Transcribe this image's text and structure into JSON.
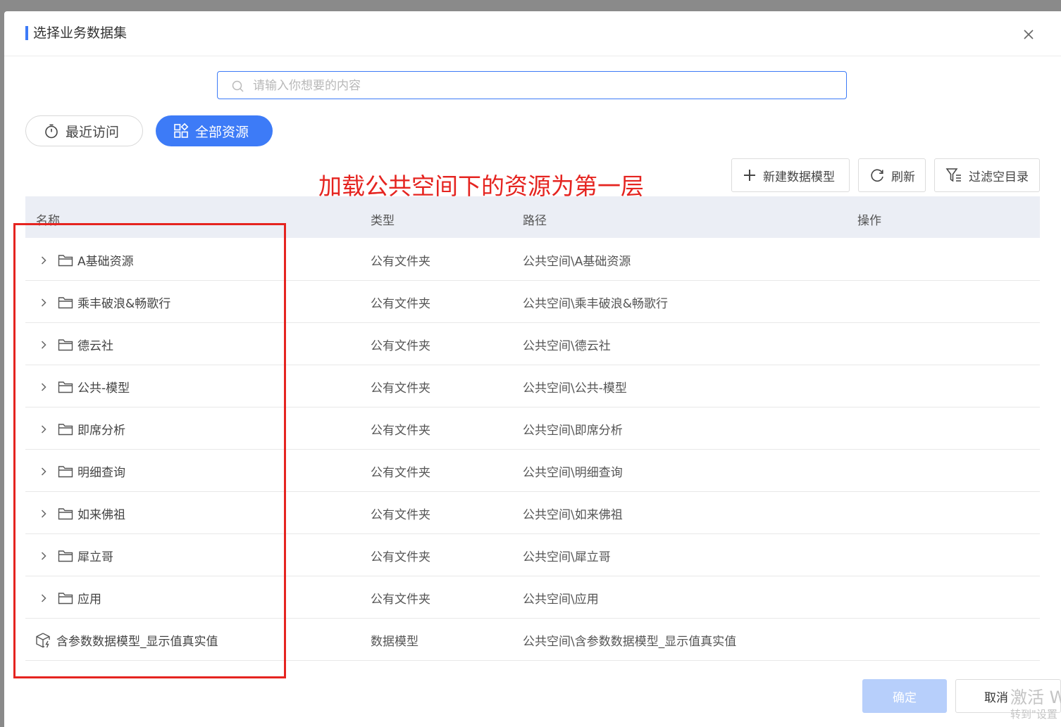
{
  "dialog": {
    "title": "选择业务数据集",
    "accent_color": "#3d7bf7"
  },
  "search": {
    "placeholder": "请输入你想要的内容",
    "value": ""
  },
  "tabs": {
    "recent_label": "最近访问",
    "all_label": "全部资源",
    "active": "全部资源"
  },
  "annotation": {
    "text": "加载公共空间下的资源为第一层",
    "color": "#e52420"
  },
  "toolbar": {
    "new_model_label": "新建数据模型",
    "refresh_label": "刷新",
    "filter_empty_label": "过滤空目录"
  },
  "table": {
    "headers": [
      "名称",
      "类型",
      "路径",
      "操作"
    ],
    "rows": [
      {
        "name": "A基础资源",
        "type": "公有文件夹",
        "path": "公共空间\\A基础资源",
        "kind": "folder"
      },
      {
        "name": "乘丰破浪&畅歌行",
        "type": "公有文件夹",
        "path": "公共空间\\乘丰破浪&畅歌行",
        "kind": "folder"
      },
      {
        "name": "德云社",
        "type": "公有文件夹",
        "path": "公共空间\\德云社",
        "kind": "folder"
      },
      {
        "name": "公共-模型",
        "type": "公有文件夹",
        "path": "公共空间\\公共-模型",
        "kind": "folder"
      },
      {
        "name": "即席分析",
        "type": "公有文件夹",
        "path": "公共空间\\即席分析",
        "kind": "folder"
      },
      {
        "name": "明细查询",
        "type": "公有文件夹",
        "path": "公共空间\\明细查询",
        "kind": "folder"
      },
      {
        "name": "如来佛祖",
        "type": "公有文件夹",
        "path": "公共空间\\如来佛祖",
        "kind": "folder"
      },
      {
        "name": "犀立哥",
        "type": "公有文件夹",
        "path": "公共空间\\犀立哥",
        "kind": "folder"
      },
      {
        "name": "应用",
        "type": "公有文件夹",
        "path": "公共空间\\应用",
        "kind": "folder"
      },
      {
        "name": "含参数数据模型_显示值真实值",
        "type": "数据模型",
        "path": "公共空间\\含参数数据模型_显示值真实值",
        "kind": "model"
      }
    ]
  },
  "footer": {
    "ok_label": "确定",
    "cancel_label": "取消",
    "watermark_line1": "激活 W",
    "watermark_line2": "转到\"设置"
  }
}
